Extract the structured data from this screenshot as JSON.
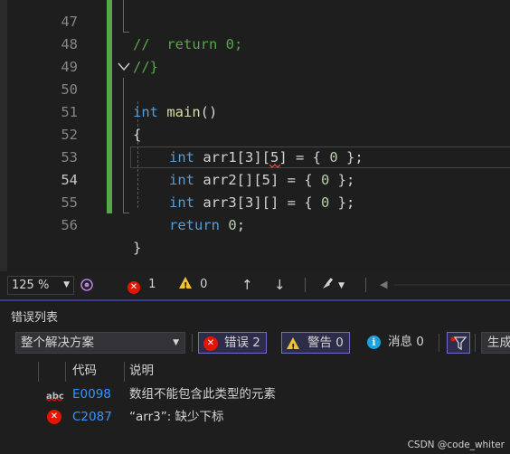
{
  "editor": {
    "lines": [
      {
        "num": "47",
        "text": "//  return 0;"
      },
      {
        "num": "48",
        "text": "//}"
      },
      {
        "num": "49",
        "text": ""
      },
      {
        "num": "50",
        "kw": "int",
        "fn": "main",
        "rest": "()"
      },
      {
        "num": "51",
        "text": "{"
      },
      {
        "num": "52",
        "kw": "int",
        "id": "arr1[3][5] = { ",
        "num_val": "0",
        "tail": " };"
      },
      {
        "num": "53",
        "kw": "int",
        "id": "arr2[][5] = { ",
        "num_val": "0",
        "tail": " };"
      },
      {
        "num": "54",
        "kw": "int",
        "id": "arr3[3][] = { ",
        "num_val": "0",
        "tail": " };"
      },
      {
        "num": "55",
        "kw": "return",
        "num_val": "0",
        "tail": ";"
      },
      {
        "num": "56",
        "text": "}"
      }
    ]
  },
  "statusbar": {
    "zoom": "125 %",
    "errors": "1",
    "warnings": "0"
  },
  "error_list": {
    "title": "错误列表",
    "scope": "整个解决方案",
    "errors_btn": "错误 2",
    "warnings_btn": "警告 0",
    "messages_btn": "消息 0",
    "build_btn": "生成",
    "columns": {
      "code": "代码",
      "description": "说明"
    },
    "rows": [
      {
        "code": "E0098",
        "description": "数组不能包含此类型的元素",
        "icon": "intellisense-squiggle-icon"
      },
      {
        "code": "C2087",
        "description": "“arr3”: 缺少下标",
        "icon": "error-icon"
      }
    ]
  },
  "watermark": "CSDN @code_whiter",
  "colors": {
    "keyword": "#569cd6",
    "function": "#dcdcaa",
    "number": "#b5cea8",
    "comment": "#57a64a",
    "error": "#e51400",
    "warning": "#f2c230",
    "link": "#3794ff"
  }
}
